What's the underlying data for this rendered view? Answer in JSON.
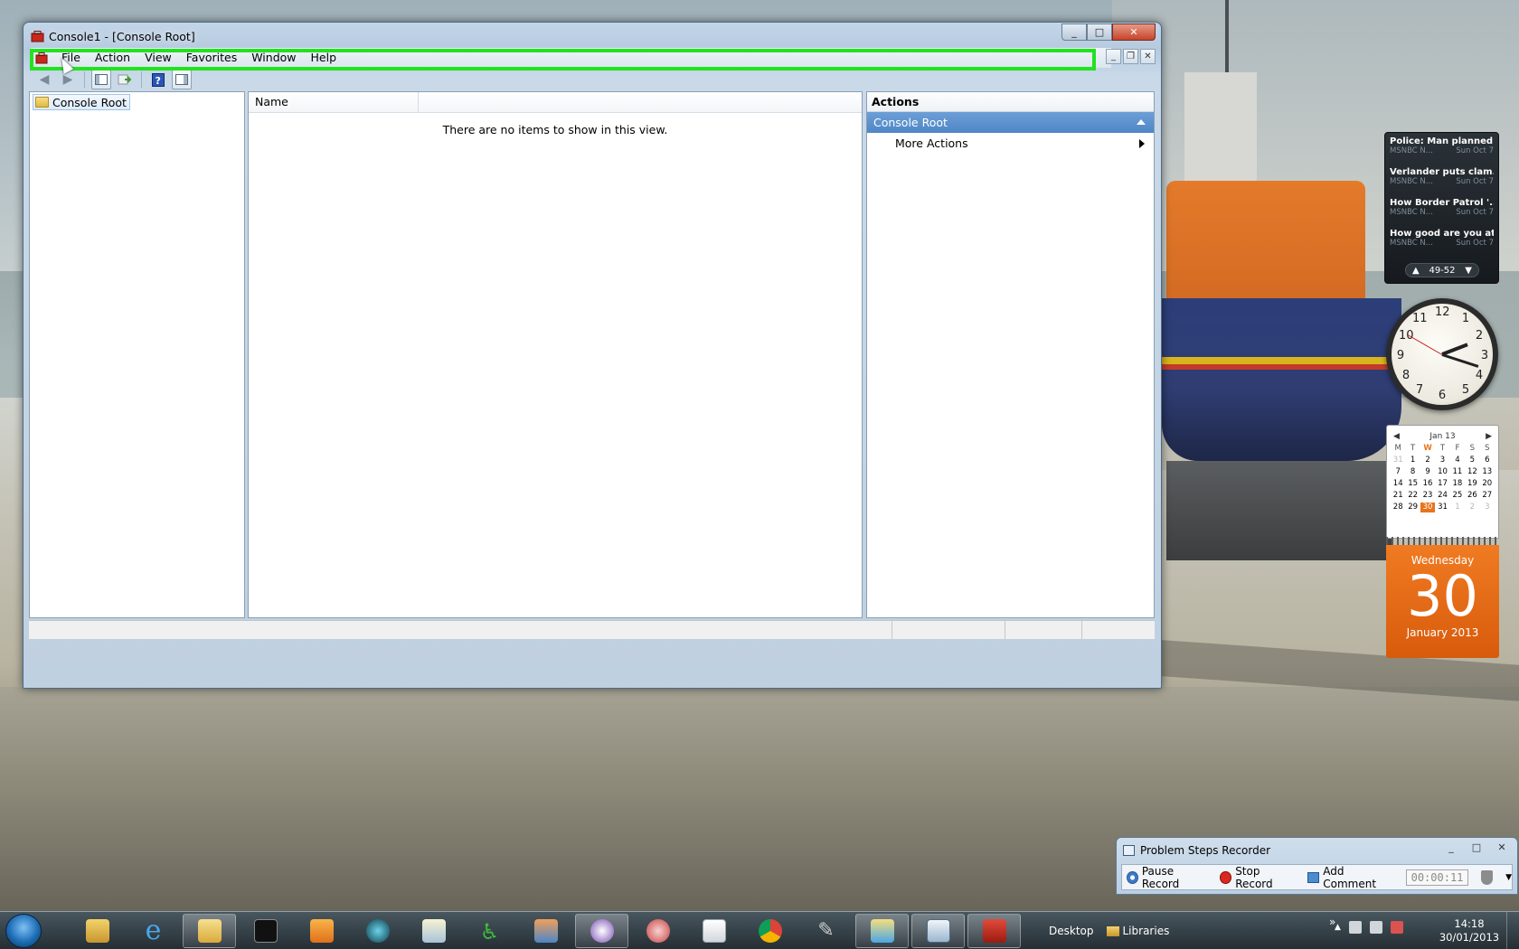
{
  "window": {
    "title": "Console1 - [Console Root]",
    "caption": {
      "minimize": "_",
      "maximize": "□",
      "close": "✕"
    }
  },
  "menu": {
    "items": [
      "File",
      "Action",
      "View",
      "Favorites",
      "Window",
      "Help"
    ],
    "highlight_color": "#22e21f"
  },
  "inner_caption": {
    "minimize": "_",
    "restore": "❐",
    "close": "✕"
  },
  "tree": {
    "root": "Console Root"
  },
  "list": {
    "column_name": "Name",
    "empty_message": "There are no items to show in this view."
  },
  "actions": {
    "header": "Actions",
    "section": "Console Root",
    "more": "More Actions"
  },
  "feed": {
    "items": [
      {
        "title": "Police: Man planned ...",
        "source": "MSNBC N...",
        "date": "Sun Oct 7"
      },
      {
        "title": "Verlander puts clam...",
        "source": "MSNBC N...",
        "date": "Sun Oct 7"
      },
      {
        "title": "How Border Patrol '...",
        "source": "MSNBC N...",
        "date": "Sun Oct 7"
      },
      {
        "title": "How good are you at...",
        "source": "MSNBC N...",
        "date": "Sun Oct 7"
      }
    ],
    "range": "49-52"
  },
  "clock": {
    "numbers": [
      "12",
      "1",
      "2",
      "3",
      "4",
      "5",
      "6",
      "7",
      "8",
      "9",
      "10",
      "11"
    ],
    "hour": 2,
    "minute": 18
  },
  "calendar": {
    "month": "Jan 13",
    "dow": [
      "M",
      "T",
      "W",
      "T",
      "F",
      "S",
      "S"
    ],
    "weeks": [
      [
        "31",
        "1",
        "2",
        "3",
        "4",
        "5",
        "6"
      ],
      [
        "7",
        "8",
        "9",
        "10",
        "11",
        "12",
        "13"
      ],
      [
        "14",
        "15",
        "16",
        "17",
        "18",
        "19",
        "20"
      ],
      [
        "21",
        "22",
        "23",
        "24",
        "25",
        "26",
        "27"
      ],
      [
        "28",
        "29",
        "30",
        "31",
        "1",
        "2",
        "3"
      ]
    ],
    "today": "30",
    "day_name": "Wednesday",
    "day_number": "30",
    "month_year": "January 2013"
  },
  "psr": {
    "title": "Problem Steps Recorder",
    "pause": "Pause Record",
    "stop": "Stop Record",
    "comment": "Add Comment",
    "timer": "00:00:11"
  },
  "taskbar": {
    "desktop": "Desktop",
    "libraries": "Libraries",
    "time": "14:18",
    "date": "30/01/2013",
    "overflow": "»"
  }
}
